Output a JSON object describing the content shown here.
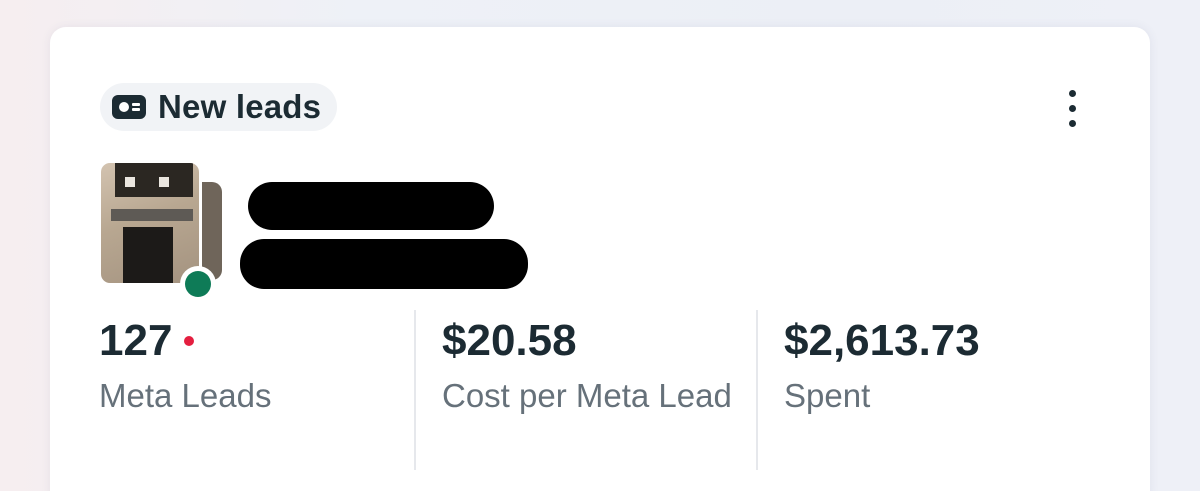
{
  "card": {
    "tag": {
      "icon": "lead-card-icon",
      "label": "New leads"
    },
    "more_menu": {
      "icon": "more-vertical-icon"
    },
    "account": {
      "avatar": "account-avatar",
      "status": "online",
      "status_color": "#0e7b57",
      "name": "",
      "subtitle": ""
    },
    "stats": [
      {
        "value": "127",
        "label": "Meta Leads",
        "alert_color": "#e41e3f"
      },
      {
        "value": "$20.58",
        "label": "Cost per Meta Lead"
      },
      {
        "value": "$2,613.73",
        "label": "Spent"
      }
    ]
  }
}
